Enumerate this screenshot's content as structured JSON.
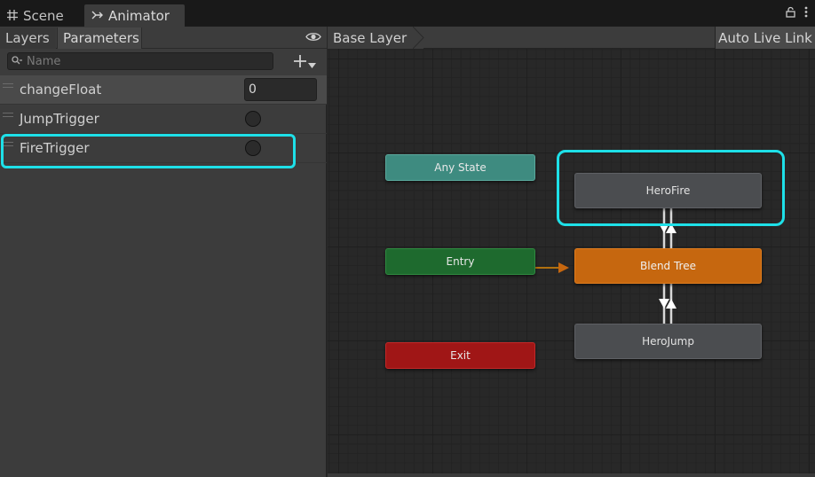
{
  "tabs": {
    "scene_label": "Scene",
    "animator_label": "Animator"
  },
  "left_panel": {
    "layers_tab": "Layers",
    "parameters_tab": "Parameters",
    "search_placeholder": "Name",
    "parameters": [
      {
        "name": "changeFloat",
        "type": "float",
        "value": "0"
      },
      {
        "name": "JumpTrigger",
        "type": "trigger"
      },
      {
        "name": "FireTrigger",
        "type": "trigger"
      }
    ]
  },
  "graph": {
    "breadcrumb": "Base Layer",
    "auto_live_link": "Auto Live Link",
    "nodes": {
      "any_state": "Any State",
      "entry": "Entry",
      "exit": "Exit",
      "hero_fire": "HeroFire",
      "blend_tree": "Blend Tree",
      "hero_jump": "HeroJump"
    }
  },
  "colors": {
    "highlight": "#1ee0e8",
    "any_state": "#3e8b80",
    "entry": "#1e6a2e",
    "exit": "#a01616",
    "blend_tree": "#c6670f",
    "state": "#4b4d50"
  }
}
